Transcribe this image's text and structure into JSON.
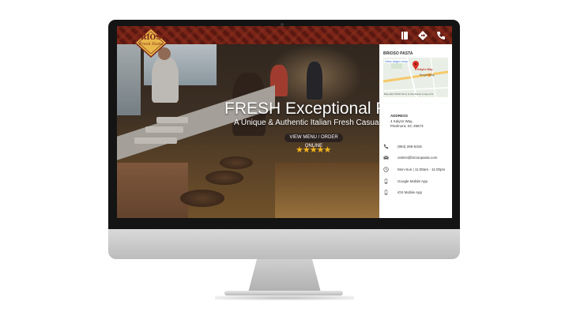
{
  "header": {
    "logo_name": "BRIOSO",
    "logo_tagline": "Fresh Pasta",
    "icons": [
      "menu-book-icon",
      "directions-icon",
      "phone-icon"
    ]
  },
  "hero": {
    "title": "FRESH Exceptional Flavors",
    "subtitle": "A Unique & Authentic Italian Fresh Casual Experience",
    "cta_label": "VIEW MENU / ORDER ONLINE",
    "stars": "★★★★★",
    "rating": 5
  },
  "panel": {
    "title": "BRIOSO PASTA",
    "map": {
      "link": "View larger map",
      "pin_label": "4 Kalyns Way",
      "nearby": "Burger King",
      "credit": "Map data ©2019   Terms of Use   Report a map error"
    },
    "address_label": "ADDRESS",
    "address_line1": "4 Kalyns Way,",
    "address_line2": "Piedmont, SC 29673",
    "contacts": [
      {
        "icon": "phone-icon",
        "text": "(864) 269-5318"
      },
      {
        "icon": "email-icon",
        "text": "orders@briosopasta.com"
      },
      {
        "icon": "clock-icon",
        "text": "Mon-Sun | 11:00am - 11:00pm"
      },
      {
        "icon": "android-icon",
        "text": "Google Mobile App"
      },
      {
        "icon": "apple-icon",
        "text": "iOS Mobile App"
      }
    ]
  },
  "colors": {
    "header_red": "#7a2418",
    "logo_gold": "#e8b64a",
    "star_gold": "#f3b51c",
    "cta_dark": "#2b2220"
  }
}
